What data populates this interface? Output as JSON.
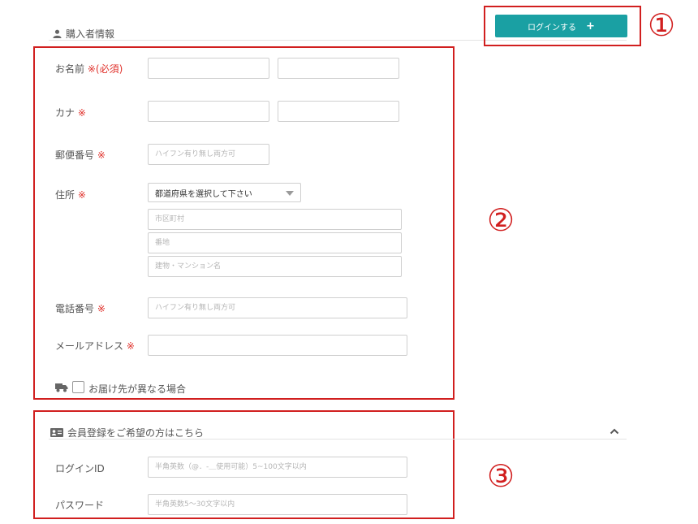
{
  "header": {
    "section_title": "購入者情報",
    "login_button": "ログインする",
    "login_plus": "+"
  },
  "annotations": {
    "one": "①",
    "two": "②",
    "three": "③"
  },
  "form": {
    "name_label": "お名前",
    "name_req": "※(必須)",
    "kana_label": "カナ",
    "zip_label": "郵便番号",
    "zip_placeholder": "ハイフン有り無し両方可",
    "address_label": "住所",
    "prefecture_select": "都道府県を選択して下さい",
    "city_placeholder": "市区町村",
    "street_placeholder": "番地",
    "building_placeholder": "建物・マンション名",
    "phone_label": "電話番号",
    "phone_placeholder": "ハイフン有り無し両方可",
    "email_label": "メールアドレス",
    "req_mark": "※",
    "delivery_label": "お届け先が異なる場合"
  },
  "member": {
    "section_title": "会員登録をご希望の方はこちら",
    "login_id_label": "ログインID",
    "login_id_placeholder": "半角英数（@．-＿使用可能）5~100文字以内",
    "password_label": "パスワード",
    "password_placeholder": "半角英数5～30文字以内"
  }
}
